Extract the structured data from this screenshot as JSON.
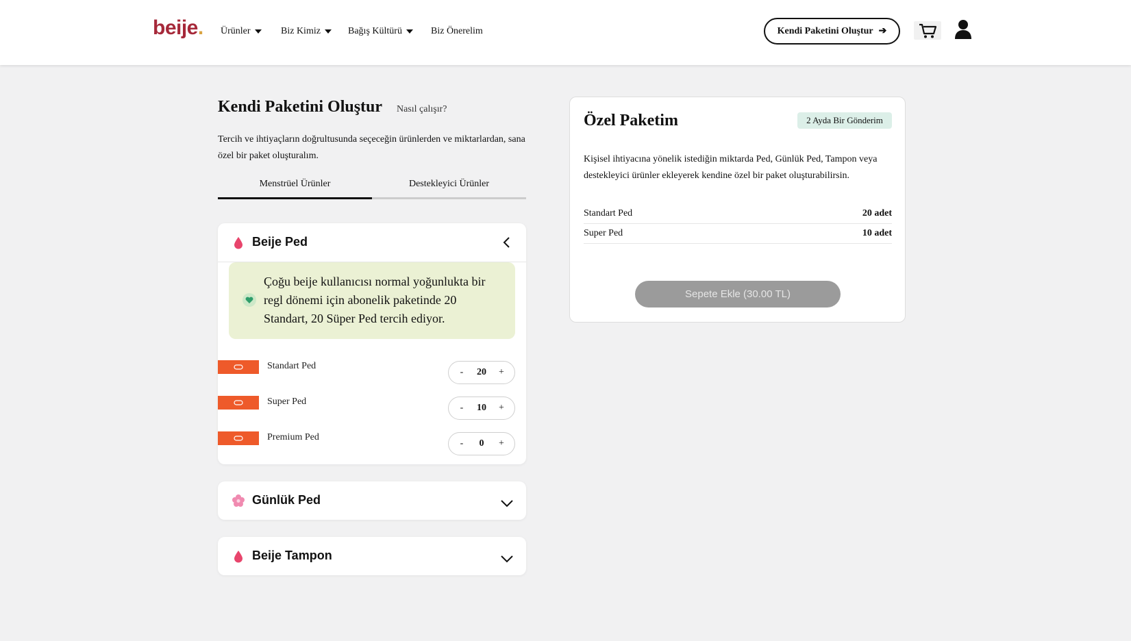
{
  "header": {
    "logo_text": "beije",
    "logo_dot": ".",
    "nav": [
      "Ürünler",
      "Biz Kimiz",
      "Bağış Kültürü",
      "Biz Önerelim"
    ],
    "cta_label": "Kendi Paketini Oluştur",
    "cta_arrow": "➔"
  },
  "builder": {
    "title": "Kendi Paketini Oluştur",
    "how_link": "Nasıl çalışır?",
    "intro": "Tercih ve ihtiyaçların doğrultusunda seçeceğin ürünlerden ve miktarlardan, sana özel bir paket oluşturalım.",
    "tabs": [
      {
        "label": "Menstrüel Ürünler",
        "active": true
      },
      {
        "label": "Destekleyici Ürünler",
        "active": false
      }
    ]
  },
  "categories": [
    {
      "title": "Beije Ped",
      "expanded": true,
      "tip": "Çoğu beije kullanıcısı normal yoğunlukta bir regl dönemi için abonelik paketinde 20 Standart, 20 Süper Ped tercih ediyor.",
      "products": [
        {
          "label": "Standart Ped",
          "qty": "20"
        },
        {
          "label": "Super Ped",
          "qty": "10"
        },
        {
          "label": "Premium Ped",
          "qty": "0"
        }
      ]
    },
    {
      "title": "Günlük Ped",
      "expanded": false
    },
    {
      "title": "Beije Tampon",
      "expanded": false
    }
  ],
  "stepper": {
    "minus": "-",
    "plus": "+"
  },
  "summary": {
    "title": "Özel Paketim",
    "frequency": "2 Ayda Bir Gönderim",
    "description": "Kişisel ihtiyacına yönelik istediğin miktarda Ped, Günlük Ped, Tampon veya destekleyici ürünler ekleyerek kendine özel bir paket oluşturabilirsin.",
    "items": [
      {
        "name": "Standart Ped",
        "qty": "20 adet"
      },
      {
        "name": "Super Ped",
        "qty": "10 adet"
      }
    ],
    "add_to_cart": "Sepete Ekle (30.00 TL)"
  },
  "colors": {
    "brand": "#a6293a",
    "drop_pink": "#e8456c",
    "product_tag": "#ee5a2a",
    "tip_bg": "#ebf1d4",
    "badge_bg": "#dcefe8"
  }
}
